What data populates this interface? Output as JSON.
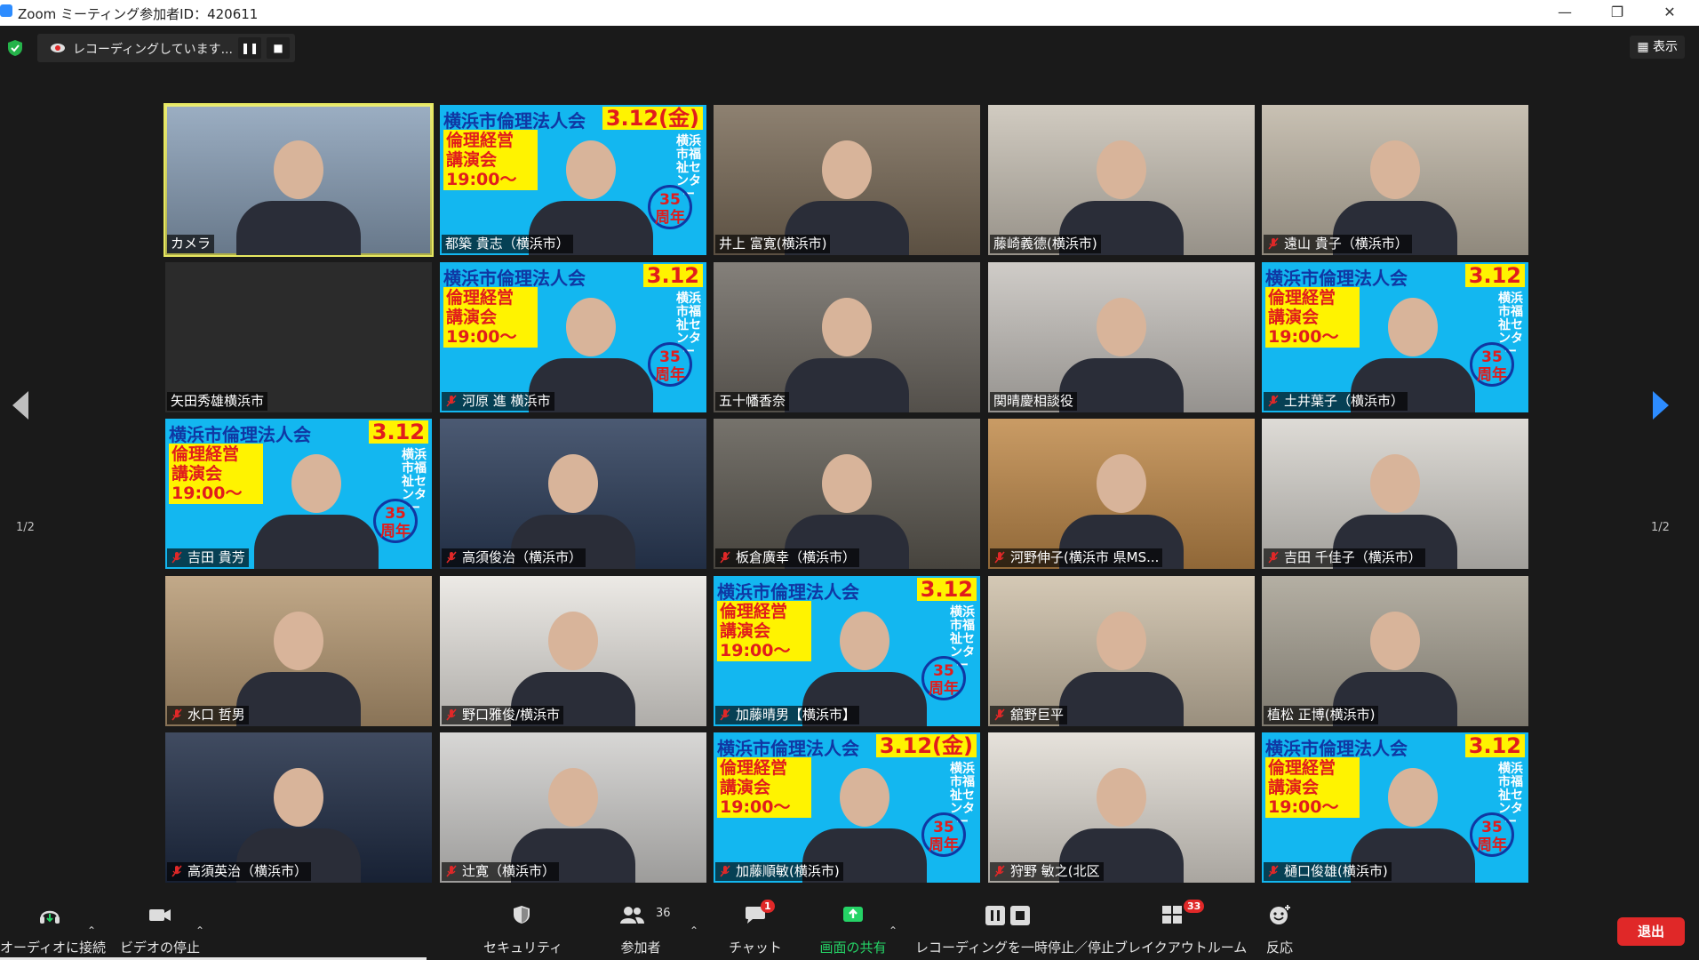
{
  "window": {
    "title": "Zoom ミーティング参加者ID：420611",
    "minimize": "—",
    "maximize": "❐",
    "close": "✕"
  },
  "recording": {
    "status": "レコーディングしています...",
    "pause": "❚❚",
    "stop": "■"
  },
  "view_button": "表示",
  "pagination": {
    "left": "1/2",
    "right": "1/2"
  },
  "poster": {
    "title": "横浜市倫理法人会",
    "date_full": "3.12(金)",
    "date_short": "3.12",
    "box": "倫理経営\n講演会\n19:00〜",
    "side": "横浜市福祉センター",
    "years": "35\n周年"
  },
  "participants": [
    "カメラ",
    "都築 貴志（横浜市）",
    "井上 富寛(横浜市)",
    "藤崎義德(横浜市)",
    "遠山 貴子（横浜市）",
    "矢田秀雄横浜市",
    "河原 進 横浜市",
    "五十幡香奈",
    "関晴慶相談役",
    "土井葉子（横浜市）",
    "吉田 貴芳",
    "高須俊治（横浜市）",
    "板倉廣幸（横浜市）",
    "河野伸子(横浜市 県MS...",
    "吉田 千佳子（横浜市）",
    "水口 哲男",
    "野口雅俊/横浜市",
    "加藤晴男【横浜市】",
    "舘野巨平",
    "植松 正博(横浜市)",
    "高須英治（横浜市）",
    "辻寛（横浜市）",
    "加藤順敏(横浜市)",
    "狩野 敏之(北区",
    "樋口俊雄(横浜市)"
  ],
  "muted": [
    false,
    false,
    false,
    false,
    true,
    false,
    true,
    false,
    false,
    true,
    true,
    true,
    true,
    true,
    true,
    true,
    true,
    true,
    true,
    false,
    true,
    true,
    true,
    true,
    true
  ],
  "toolbar": {
    "audio": "オーディオに接続",
    "video": "ビデオの停止",
    "security": "セキュリティ",
    "participants": "参加者",
    "participants_count": "36",
    "chat": "チャット",
    "chat_badge": "1",
    "share": "画面の共有",
    "recording": "レコーディングを一時停止／停止",
    "breakout": "ブレイクアウトルーム",
    "breakout_badge": "33",
    "reactions": "反応",
    "leave": "退出"
  },
  "colors": {
    "accent": "#2d8cff",
    "share_green": "#25d366",
    "leave_red": "#e02828",
    "active_speaker": "#e7e861"
  }
}
